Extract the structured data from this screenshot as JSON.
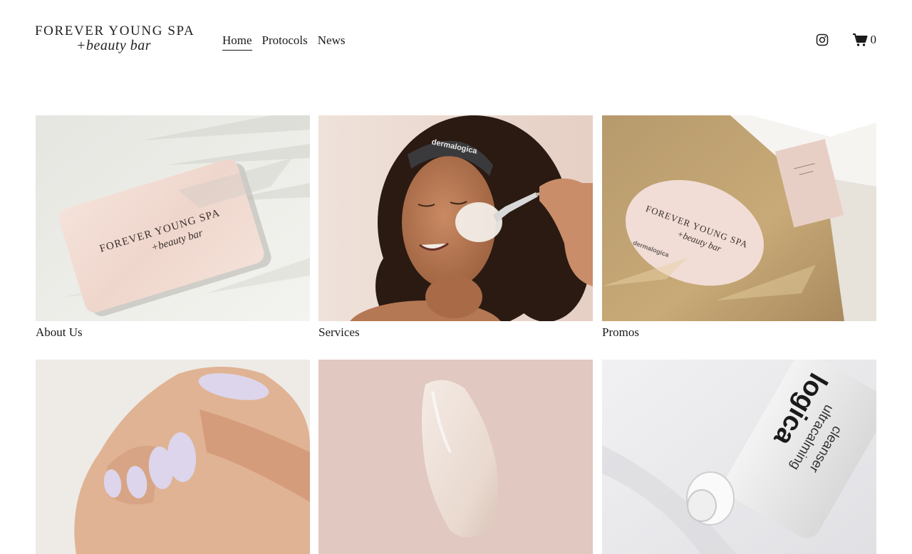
{
  "brand": {
    "name": "FOREVER YOUNG SPA",
    "tagline": "+beauty bar"
  },
  "nav": [
    {
      "label": "Home",
      "active": true
    },
    {
      "label": "Protocols",
      "active": false
    },
    {
      "label": "News",
      "active": false
    }
  ],
  "header": {
    "instagram_icon": "instagram-icon",
    "cart_icon": "cart-icon",
    "cart_count": "0"
  },
  "tiles": [
    {
      "label": "About Us",
      "image": "business card on marble"
    },
    {
      "label": "Services",
      "image": "woman receiving facial mask"
    },
    {
      "label": "Promos",
      "image": "kraft bag with sticker"
    },
    {
      "label": "",
      "image": "manicured nails"
    },
    {
      "label": "",
      "image": "cream swatch on pink"
    },
    {
      "label": "",
      "image": "cleanser tube"
    }
  ],
  "image_text": {
    "card_line1": "FOREVER YOUNG SPA",
    "card_line2": "+beauty bar",
    "headband": "dermalogica",
    "sticker_line1": "FOREVER YOUNG SPA",
    "sticker_line2": "+beauty bar",
    "sticker_brand": "dermalogica",
    "tube_brand": "logica",
    "tube_product1": "ultracalming",
    "tube_product2": "cleanser"
  },
  "colors": {
    "text": "#1a1a1a",
    "background": "#ffffff",
    "swatch_pink": "#e1c8c0"
  }
}
